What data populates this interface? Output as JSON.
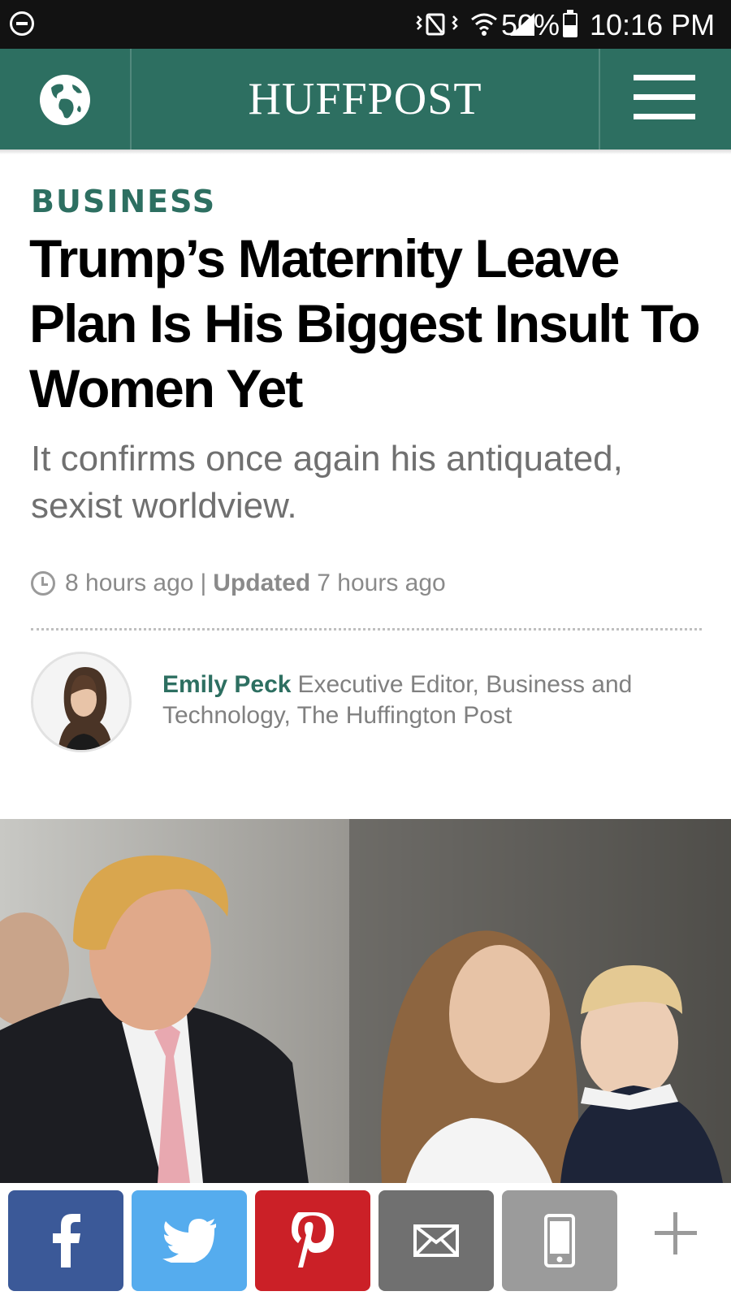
{
  "status_bar": {
    "battery": "50%",
    "time": "10:16 PM",
    "icons": [
      "dnd-icon",
      "vibrate-icon",
      "wifi-icon",
      "signal-icon",
      "battery-icon"
    ]
  },
  "header": {
    "brand": "HUFFPOST",
    "left_icon": "globe-icon",
    "right_icon": "hamburger-menu-icon",
    "brand_color": "#2d6f61"
  },
  "article": {
    "section": "BUSINESS",
    "headline": "Trump’s Maternity Leave Plan Is His Biggest Insult To Women Yet",
    "dek": "It confirms once again his antiquated, sexist worldview.",
    "meta": {
      "published": "8 hours ago",
      "separator": "|",
      "updated_label": "Updated",
      "updated": "7 hours ago"
    },
    "author": {
      "name": "Emily Peck",
      "title": "Executive Editor, Business and Technology, The Huffington Post"
    }
  },
  "share_bar": {
    "buttons": [
      {
        "name": "facebook",
        "icon": "facebook-icon",
        "color": "#3b5998"
      },
      {
        "name": "twitter",
        "icon": "twitter-icon",
        "color": "#55acee"
      },
      {
        "name": "pinterest",
        "icon": "pinterest-icon",
        "color": "#cb2027"
      },
      {
        "name": "email",
        "icon": "envelope-icon",
        "color": "#707070"
      },
      {
        "name": "sms",
        "icon": "phone-icon",
        "color": "#9b9b9b"
      },
      {
        "name": "more",
        "icon": "plus-icon",
        "color": "#9a9a9a"
      }
    ]
  }
}
